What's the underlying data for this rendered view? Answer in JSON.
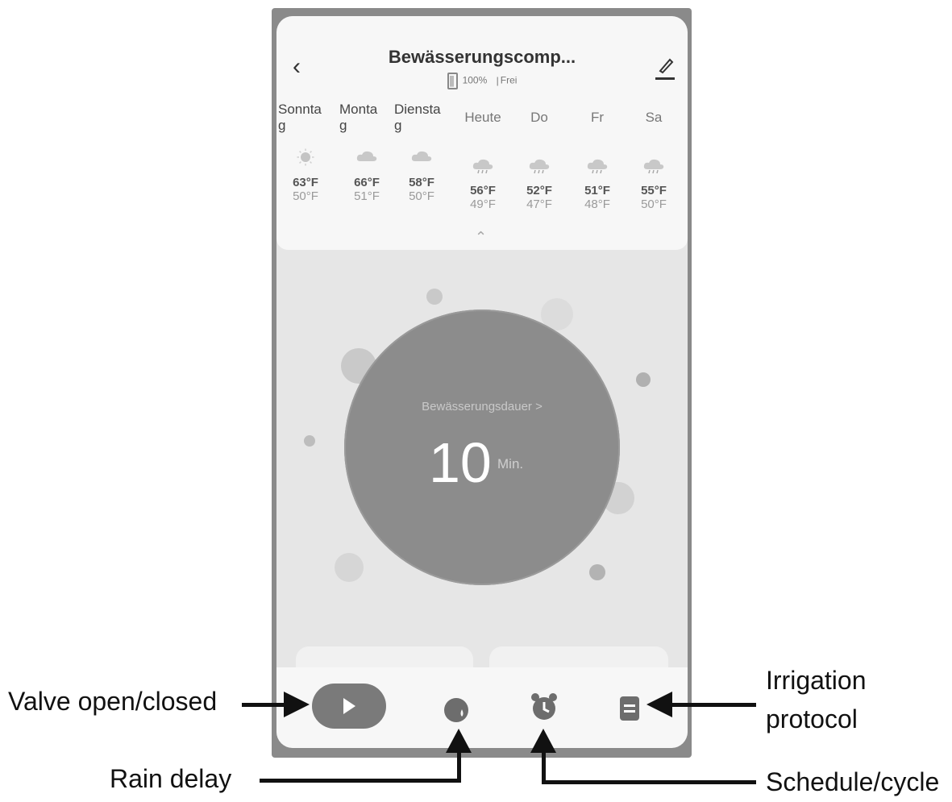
{
  "header": {
    "back_icon": "back-chevron-icon",
    "title": "Bewässerungscomp...",
    "battery": "100%",
    "separator": "|",
    "status": "Frei",
    "edit_icon": "pencil-icon"
  },
  "forecast": [
    {
      "day": "Sonnta\ng",
      "icon": "sun-icon",
      "high": "63°F",
      "low": "50°F"
    },
    {
      "day": "Monta\ng",
      "icon": "cloud-icon",
      "high": "66°F",
      "low": "51°F"
    },
    {
      "day": "Diensta\ng",
      "icon": "cloud-icon",
      "high": "58°F",
      "low": "50°F"
    },
    {
      "day": "Heute",
      "icon": "rain-cloud-icon",
      "high": "56°F",
      "low": "49°F"
    },
    {
      "day": "Do",
      "icon": "rain-cloud-icon",
      "high": "52°F",
      "low": "47°F"
    },
    {
      "day": "Fr",
      "icon": "rain-cloud-icon",
      "high": "51°F",
      "low": "48°F"
    },
    {
      "day": "Sa",
      "icon": "rain-cloud-icon",
      "high": "55°F",
      "low": "50°F"
    }
  ],
  "dial": {
    "label": "Bewässerungsdauer >",
    "value": "10",
    "unit": "Min."
  },
  "toolbar": {
    "valve_icon": "play-icon",
    "rain_delay_icon": "rain-delay-icon",
    "schedule_icon": "alarm-clock-icon",
    "protocol_icon": "document-icon"
  },
  "annotations": {
    "valve": "Valve open/closed",
    "rain_delay": "Rain delay",
    "irrigation_line1": "Irrigation",
    "irrigation_line2": "protocol",
    "schedule": "Schedule/cycle"
  }
}
